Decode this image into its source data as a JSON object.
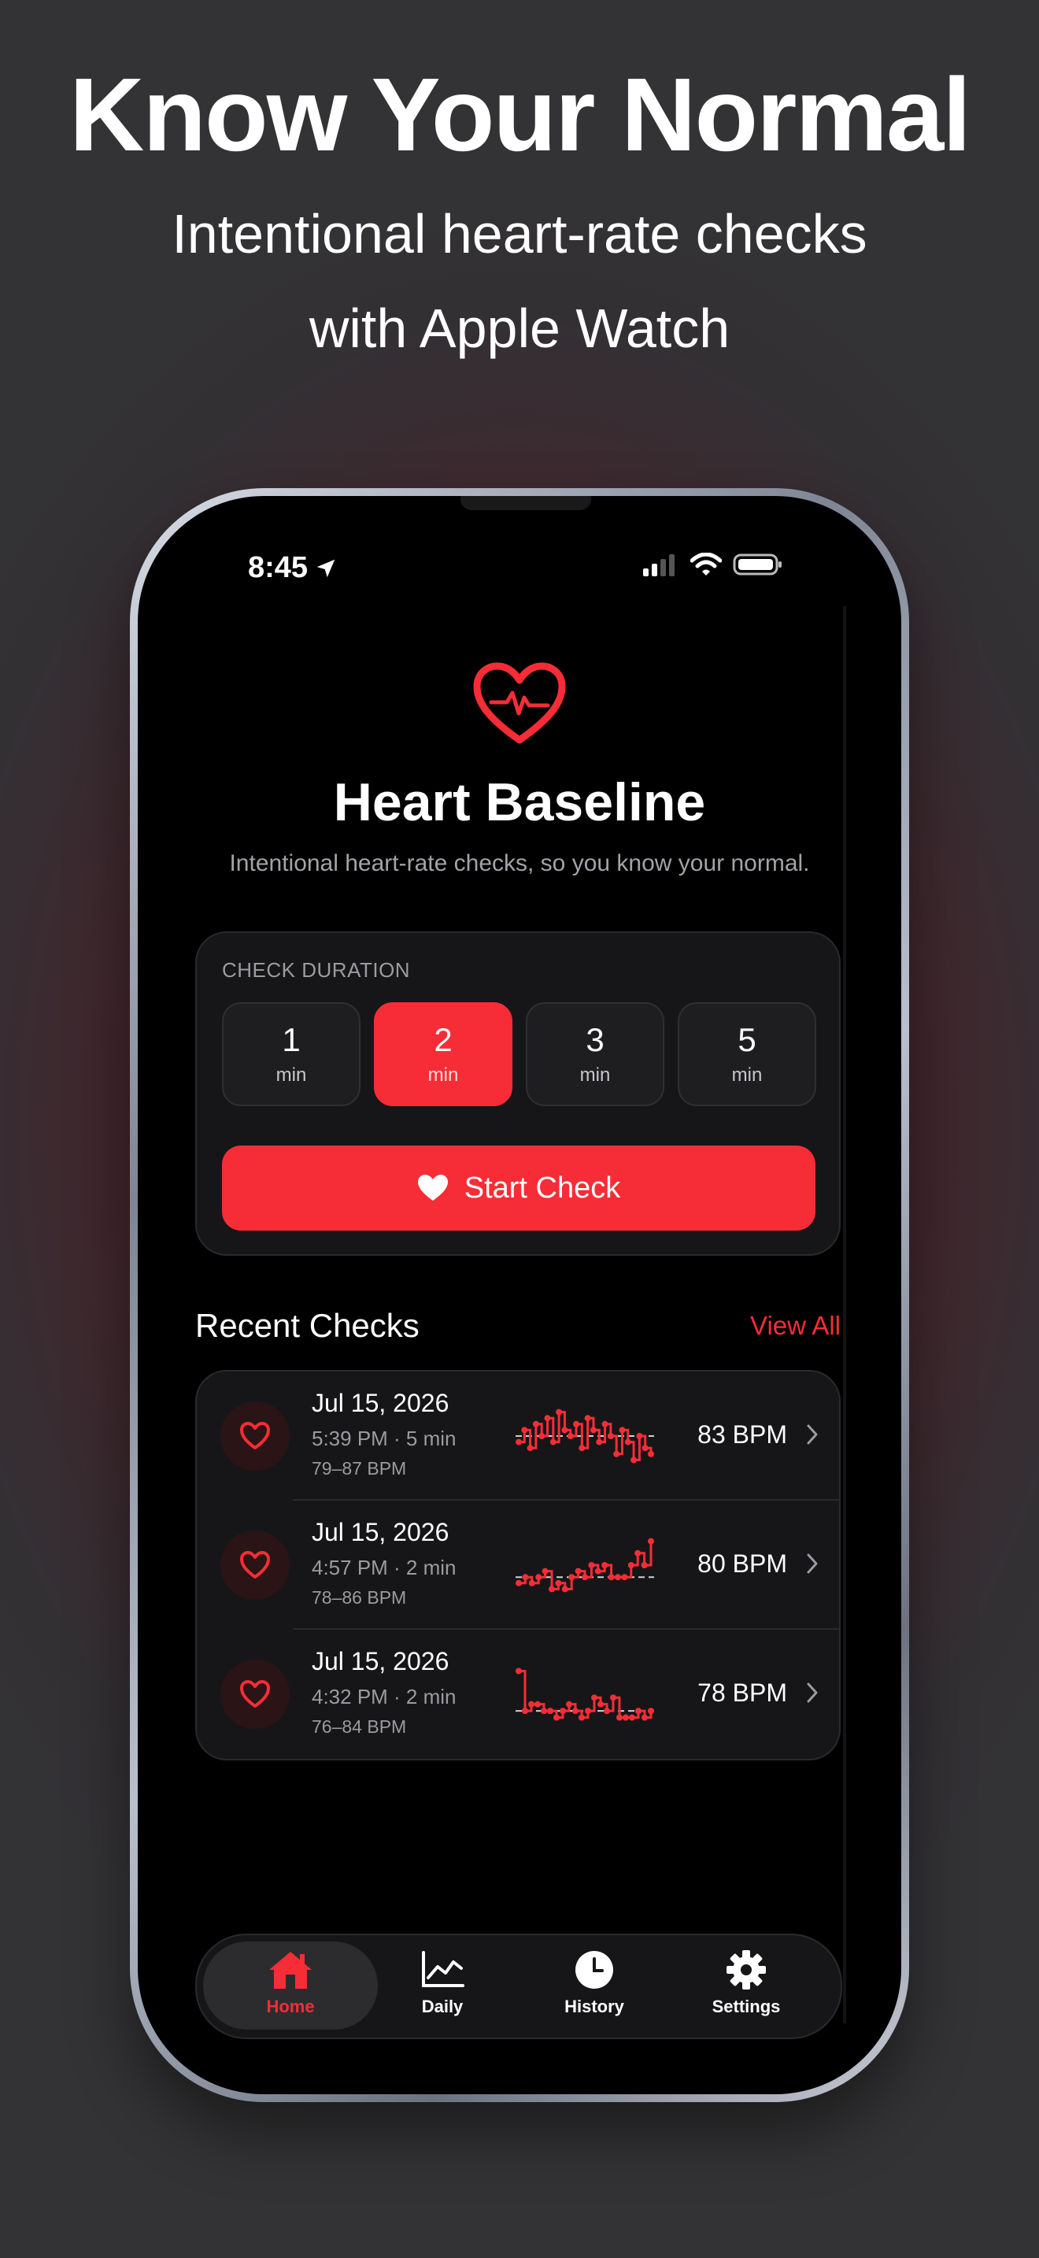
{
  "marketing": {
    "headline": "Know Your Normal",
    "subline_1": "Intentional heart-rate checks",
    "subline_2": "with Apple Watch"
  },
  "status_bar": {
    "time": "8:45",
    "icons": [
      "location-arrow-icon",
      "cellular-signal-icon",
      "wifi-icon",
      "battery-icon"
    ]
  },
  "app": {
    "title": "Heart Baseline",
    "subtitle": "Intentional heart-rate checks, so you know your normal.",
    "icon": "heart-pulse-icon"
  },
  "duration": {
    "label": "CHECK DURATION",
    "options": [
      {
        "value": "1",
        "unit": "min",
        "selected": false
      },
      {
        "value": "2",
        "unit": "min",
        "selected": true
      },
      {
        "value": "3",
        "unit": "min",
        "selected": false
      },
      {
        "value": "5",
        "unit": "min",
        "selected": false
      }
    ],
    "start_label": "Start Check"
  },
  "recent": {
    "title": "Recent Checks",
    "view_all": "View All",
    "items": [
      {
        "date": "Jul 15, 2026",
        "time": "5:39 PM · 5 min",
        "range": "79–87 BPM",
        "bpm": "83 BPM",
        "spark": [
          82,
          84,
          81,
          85,
          83,
          86,
          82,
          87,
          84,
          83,
          85,
          81,
          86,
          84,
          82,
          85,
          83,
          80,
          84,
          82,
          79,
          83,
          81,
          80
        ]
      },
      {
        "date": "Jul 15, 2026",
        "time": "4:57 PM · 2 min",
        "range": "78–86 BPM",
        "bpm": "80 BPM",
        "spark": [
          79,
          80,
          79,
          80,
          81,
          78,
          79,
          78,
          80,
          81,
          80,
          82,
          81,
          82,
          80,
          80,
          80,
          82,
          84,
          82,
          86
        ]
      },
      {
        "date": "Jul 15, 2026",
        "time": "4:32 PM · 2 min",
        "range": "76–84 BPM",
        "bpm": "78 BPM",
        "spark": [
          84,
          78,
          79,
          79,
          78,
          78,
          77,
          78,
          79,
          78,
          77,
          78,
          80,
          79,
          78,
          80,
          77,
          77,
          77,
          78,
          77,
          78
        ]
      }
    ]
  },
  "tabs": [
    {
      "label": "Home",
      "icon": "house-icon",
      "active": true
    },
    {
      "label": "Daily",
      "icon": "chart-line-icon",
      "active": false
    },
    {
      "label": "History",
      "icon": "clock-icon",
      "active": false
    },
    {
      "label": "Settings",
      "icon": "gear-icon",
      "active": false
    }
  ],
  "colors": {
    "accent": "#f62d36",
    "background": "#000000",
    "card": "#161618"
  }
}
